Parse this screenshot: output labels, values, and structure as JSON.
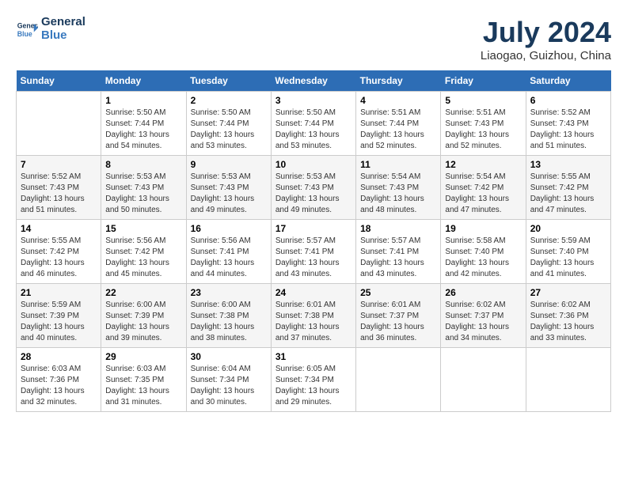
{
  "header": {
    "logo": {
      "line1": "General",
      "line2": "Blue"
    },
    "title": "July 2024",
    "location": "Liaogao, Guizhou, China"
  },
  "weekdays": [
    "Sunday",
    "Monday",
    "Tuesday",
    "Wednesday",
    "Thursday",
    "Friday",
    "Saturday"
  ],
  "weeks": [
    [
      {
        "day": "",
        "info": ""
      },
      {
        "day": "1",
        "info": "Sunrise: 5:50 AM\nSunset: 7:44 PM\nDaylight: 13 hours\nand 54 minutes."
      },
      {
        "day": "2",
        "info": "Sunrise: 5:50 AM\nSunset: 7:44 PM\nDaylight: 13 hours\nand 53 minutes."
      },
      {
        "day": "3",
        "info": "Sunrise: 5:50 AM\nSunset: 7:44 PM\nDaylight: 13 hours\nand 53 minutes."
      },
      {
        "day": "4",
        "info": "Sunrise: 5:51 AM\nSunset: 7:44 PM\nDaylight: 13 hours\nand 52 minutes."
      },
      {
        "day": "5",
        "info": "Sunrise: 5:51 AM\nSunset: 7:43 PM\nDaylight: 13 hours\nand 52 minutes."
      },
      {
        "day": "6",
        "info": "Sunrise: 5:52 AM\nSunset: 7:43 PM\nDaylight: 13 hours\nand 51 minutes."
      }
    ],
    [
      {
        "day": "7",
        "info": "Sunrise: 5:52 AM\nSunset: 7:43 PM\nDaylight: 13 hours\nand 51 minutes."
      },
      {
        "day": "8",
        "info": "Sunrise: 5:53 AM\nSunset: 7:43 PM\nDaylight: 13 hours\nand 50 minutes."
      },
      {
        "day": "9",
        "info": "Sunrise: 5:53 AM\nSunset: 7:43 PM\nDaylight: 13 hours\nand 49 minutes."
      },
      {
        "day": "10",
        "info": "Sunrise: 5:53 AM\nSunset: 7:43 PM\nDaylight: 13 hours\nand 49 minutes."
      },
      {
        "day": "11",
        "info": "Sunrise: 5:54 AM\nSunset: 7:43 PM\nDaylight: 13 hours\nand 48 minutes."
      },
      {
        "day": "12",
        "info": "Sunrise: 5:54 AM\nSunset: 7:42 PM\nDaylight: 13 hours\nand 47 minutes."
      },
      {
        "day": "13",
        "info": "Sunrise: 5:55 AM\nSunset: 7:42 PM\nDaylight: 13 hours\nand 47 minutes."
      }
    ],
    [
      {
        "day": "14",
        "info": "Sunrise: 5:55 AM\nSunset: 7:42 PM\nDaylight: 13 hours\nand 46 minutes."
      },
      {
        "day": "15",
        "info": "Sunrise: 5:56 AM\nSunset: 7:42 PM\nDaylight: 13 hours\nand 45 minutes."
      },
      {
        "day": "16",
        "info": "Sunrise: 5:56 AM\nSunset: 7:41 PM\nDaylight: 13 hours\nand 44 minutes."
      },
      {
        "day": "17",
        "info": "Sunrise: 5:57 AM\nSunset: 7:41 PM\nDaylight: 13 hours\nand 43 minutes."
      },
      {
        "day": "18",
        "info": "Sunrise: 5:57 AM\nSunset: 7:41 PM\nDaylight: 13 hours\nand 43 minutes."
      },
      {
        "day": "19",
        "info": "Sunrise: 5:58 AM\nSunset: 7:40 PM\nDaylight: 13 hours\nand 42 minutes."
      },
      {
        "day": "20",
        "info": "Sunrise: 5:59 AM\nSunset: 7:40 PM\nDaylight: 13 hours\nand 41 minutes."
      }
    ],
    [
      {
        "day": "21",
        "info": "Sunrise: 5:59 AM\nSunset: 7:39 PM\nDaylight: 13 hours\nand 40 minutes."
      },
      {
        "day": "22",
        "info": "Sunrise: 6:00 AM\nSunset: 7:39 PM\nDaylight: 13 hours\nand 39 minutes."
      },
      {
        "day": "23",
        "info": "Sunrise: 6:00 AM\nSunset: 7:38 PM\nDaylight: 13 hours\nand 38 minutes."
      },
      {
        "day": "24",
        "info": "Sunrise: 6:01 AM\nSunset: 7:38 PM\nDaylight: 13 hours\nand 37 minutes."
      },
      {
        "day": "25",
        "info": "Sunrise: 6:01 AM\nSunset: 7:37 PM\nDaylight: 13 hours\nand 36 minutes."
      },
      {
        "day": "26",
        "info": "Sunrise: 6:02 AM\nSunset: 7:37 PM\nDaylight: 13 hours\nand 34 minutes."
      },
      {
        "day": "27",
        "info": "Sunrise: 6:02 AM\nSunset: 7:36 PM\nDaylight: 13 hours\nand 33 minutes."
      }
    ],
    [
      {
        "day": "28",
        "info": "Sunrise: 6:03 AM\nSunset: 7:36 PM\nDaylight: 13 hours\nand 32 minutes."
      },
      {
        "day": "29",
        "info": "Sunrise: 6:03 AM\nSunset: 7:35 PM\nDaylight: 13 hours\nand 31 minutes."
      },
      {
        "day": "30",
        "info": "Sunrise: 6:04 AM\nSunset: 7:34 PM\nDaylight: 13 hours\nand 30 minutes."
      },
      {
        "day": "31",
        "info": "Sunrise: 6:05 AM\nSunset: 7:34 PM\nDaylight: 13 hours\nand 29 minutes."
      },
      {
        "day": "",
        "info": ""
      },
      {
        "day": "",
        "info": ""
      },
      {
        "day": "",
        "info": ""
      }
    ]
  ]
}
